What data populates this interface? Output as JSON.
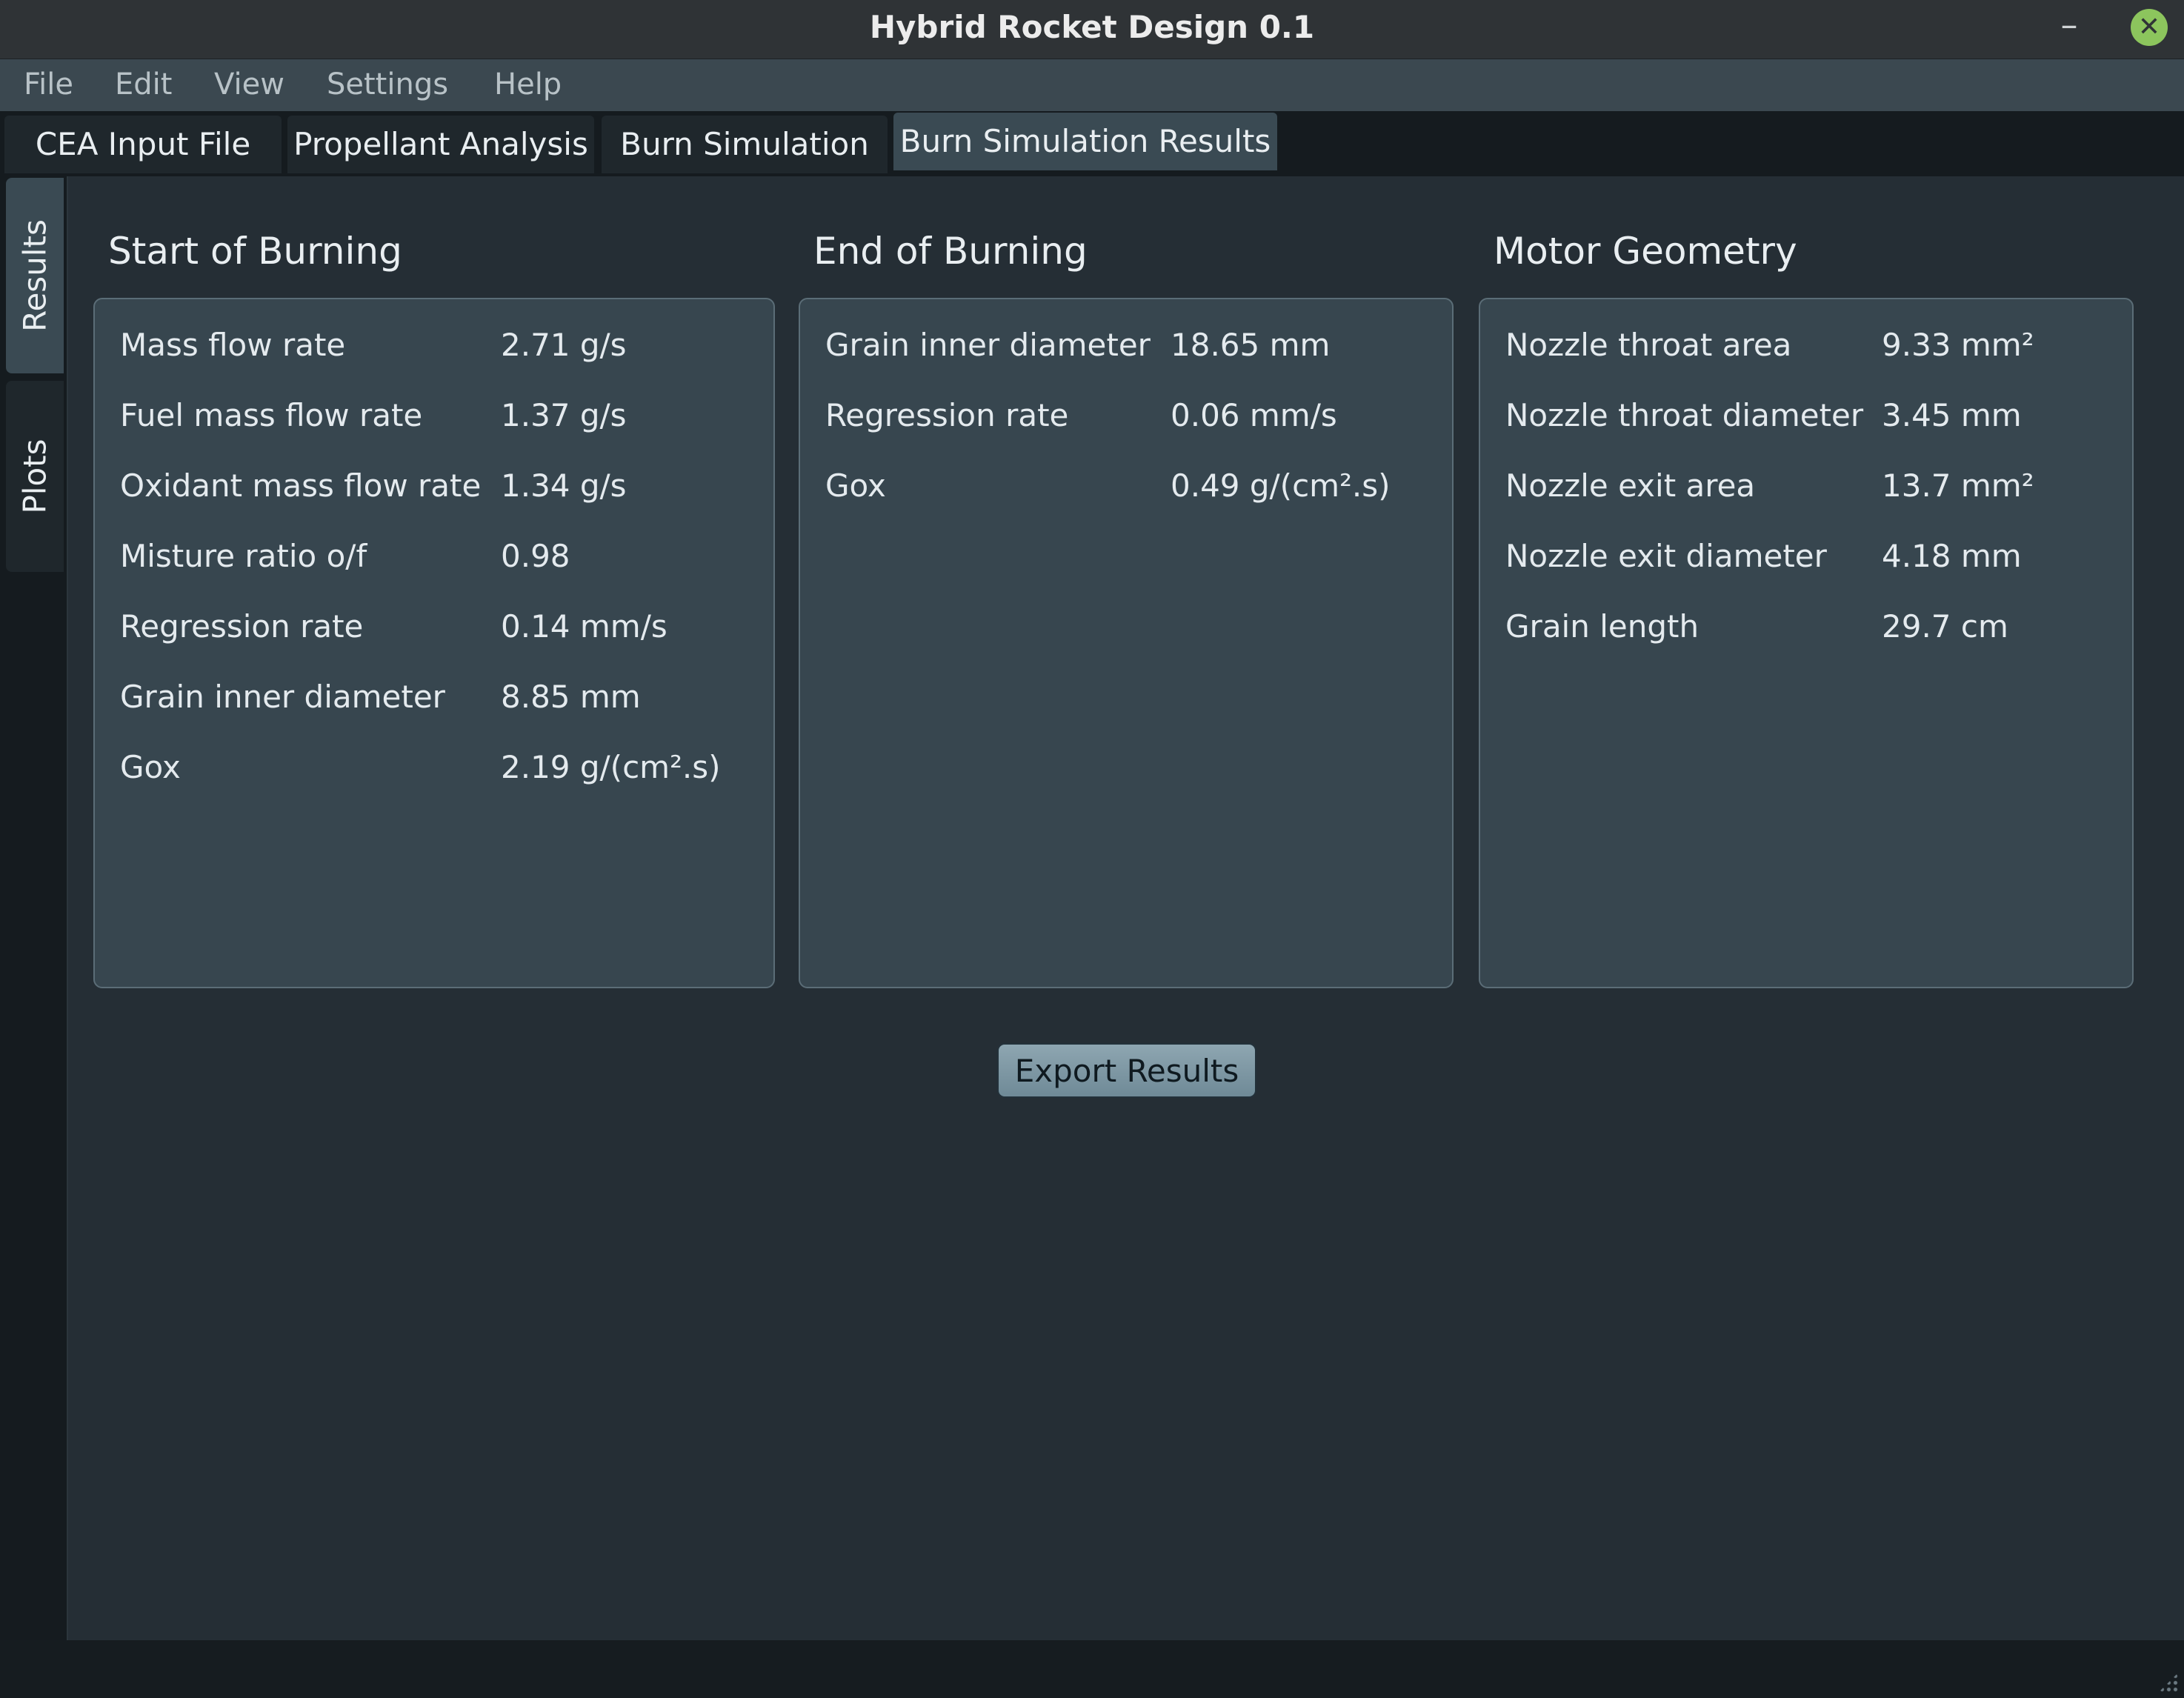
{
  "window": {
    "title": "Hybrid Rocket Design 0.1",
    "minimize_glyph": "–",
    "close_glyph": "✕"
  },
  "menu": [
    "File",
    "Edit",
    "View",
    "Settings",
    "Help"
  ],
  "tabs": [
    "CEA Input File",
    "Propellant Analysis",
    "Burn Simulation",
    "Burn Simulation Results"
  ],
  "active_tab": "Burn Simulation Results",
  "side_tabs": [
    "Results",
    "Plots"
  ],
  "active_side_tab": "Results",
  "sections": [
    {
      "title": "Start of Burning",
      "rows": [
        {
          "label": "Mass flow rate",
          "value": "2.71 g/s"
        },
        {
          "label": "Fuel mass flow rate",
          "value": "1.37 g/s"
        },
        {
          "label": "Oxidant mass flow rate",
          "value": "1.34 g/s"
        },
        {
          "label": "Misture ratio o/f",
          "value": "0.98"
        },
        {
          "label": "Regression rate",
          "value": "0.14 mm/s"
        },
        {
          "label": "Grain inner diameter",
          "value": "8.85 mm"
        },
        {
          "label": "Gox",
          "value": "2.19 g/(cm².s)"
        }
      ]
    },
    {
      "title": "End of Burning",
      "rows": [
        {
          "label": "Grain inner diameter",
          "value": "18.65 mm"
        },
        {
          "label": "Regression rate",
          "value": "0.06 mm/s"
        },
        {
          "label": "Gox",
          "value": "0.49 g/(cm².s)"
        }
      ]
    },
    {
      "title": "Motor Geometry",
      "rows": [
        {
          "label": "Nozzle throat area",
          "value": "9.33 mm²"
        },
        {
          "label": "Nozzle throat diameter",
          "value": "3.45 mm"
        },
        {
          "label": "Nozzle exit area",
          "value": "13.7 mm²"
        },
        {
          "label": "Nozzle exit diameter",
          "value": "4.18 mm"
        },
        {
          "label": "Grain length",
          "value": "29.7 cm"
        }
      ]
    }
  ],
  "export_button": "Export Results",
  "colors": {
    "accent": "#8cc55d",
    "panel": "#37464f",
    "background": "#252e35"
  }
}
